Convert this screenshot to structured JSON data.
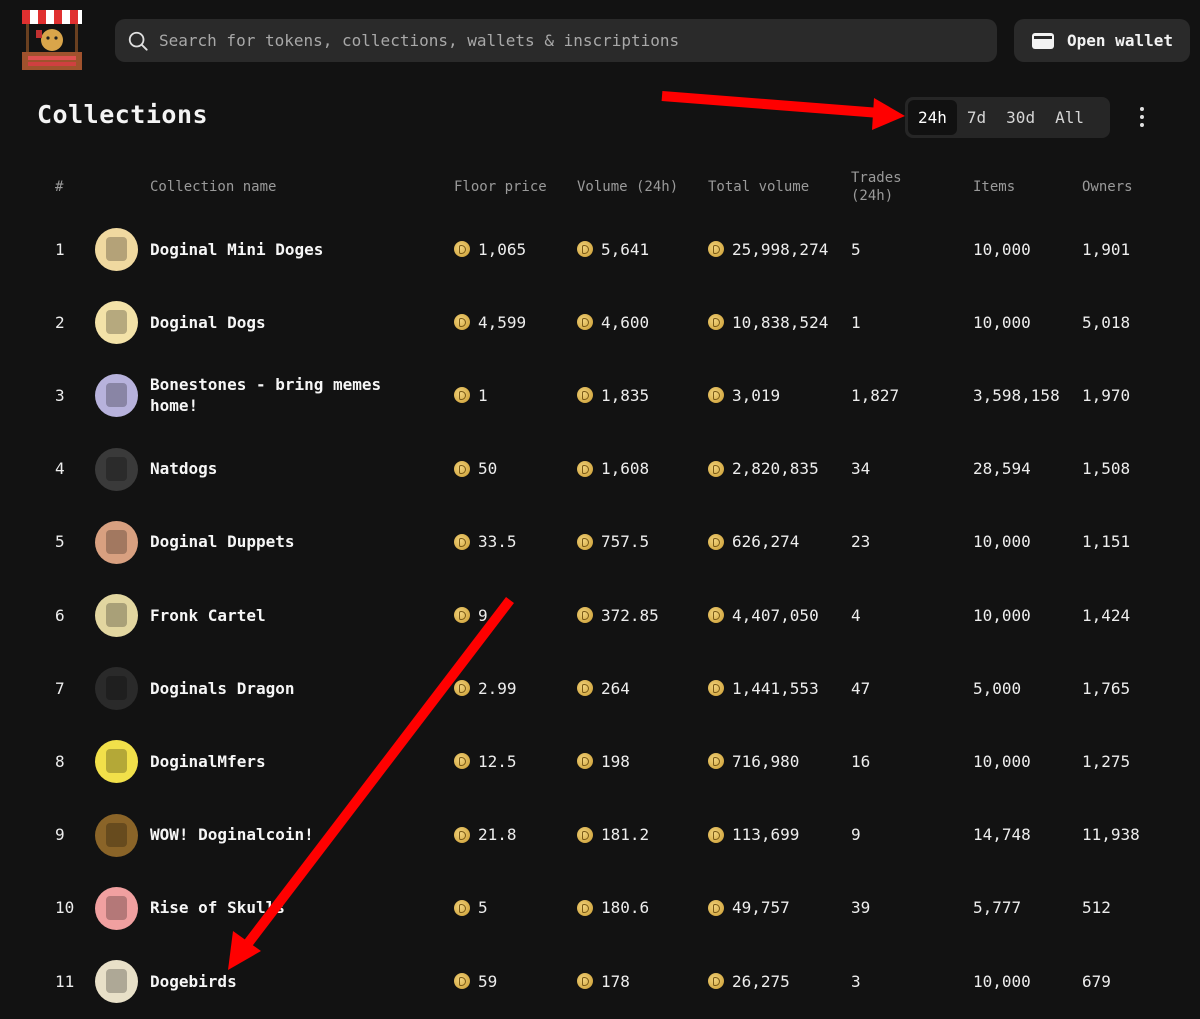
{
  "search": {
    "placeholder": "Search for tokens, collections, wallets & inscriptions"
  },
  "wallet": {
    "label": "Open wallet"
  },
  "header": {
    "title": "Collections",
    "ranges": [
      "24h",
      "7d",
      "30d",
      "All"
    ],
    "active_range": "24h"
  },
  "table": {
    "columns": {
      "rank": "#",
      "name": "Collection name",
      "floor": "Floor price",
      "volume": "Volume (24h)",
      "total": "Total volume",
      "trades": "Trades (24h)",
      "items": "Items",
      "owners": "Owners"
    },
    "rows": [
      {
        "rank": "1",
        "name": "Doginal Mini Doges",
        "floor": "1,065",
        "volume": "5,641",
        "total": "25,998,274",
        "trades": "5",
        "items": "10,000",
        "owners": "1,901",
        "avatar_color": "#f0d9a0"
      },
      {
        "rank": "2",
        "name": "Doginal Dogs",
        "floor": "4,599",
        "volume": "4,600",
        "total": "10,838,524",
        "trades": "1",
        "items": "10,000",
        "owners": "5,018",
        "avatar_color": "#f3e2a8"
      },
      {
        "rank": "3",
        "name": "Bonestones - bring memes home!",
        "floor": "1",
        "volume": "1,835",
        "total": "3,019",
        "trades": "1,827",
        "items": "3,598,158",
        "owners": "1,970",
        "avatar_color": "#b7b2dc"
      },
      {
        "rank": "4",
        "name": "Natdogs",
        "floor": "50",
        "volume": "1,608",
        "total": "2,820,835",
        "trades": "34",
        "items": "28,594",
        "owners": "1,508",
        "avatar_color": "#3a3a3a"
      },
      {
        "rank": "5",
        "name": "Doginal Duppets",
        "floor": "33.5",
        "volume": "757.5",
        "total": "626,274",
        "trades": "23",
        "items": "10,000",
        "owners": "1,151",
        "avatar_color": "#d8a080"
      },
      {
        "rank": "6",
        "name": "Fronk Cartel",
        "floor": "9",
        "volume": "372.85",
        "total": "4,407,050",
        "trades": "4",
        "items": "10,000",
        "owners": "1,424",
        "avatar_color": "#e2d6a0"
      },
      {
        "rank": "7",
        "name": "Doginals Dragon",
        "floor": "2.99",
        "volume": "264",
        "total": "1,441,553",
        "trades": "47",
        "items": "5,000",
        "owners": "1,765",
        "avatar_color": "#2a2a2a"
      },
      {
        "rank": "8",
        "name": "DoginalMfers",
        "floor": "12.5",
        "volume": "198",
        "total": "716,980",
        "trades": "16",
        "items": "10,000",
        "owners": "1,275",
        "avatar_color": "#f1e04a"
      },
      {
        "rank": "9",
        "name": "WOW! Doginalcoin!",
        "floor": "21.8",
        "volume": "181.2",
        "total": "113,699",
        "trades": "9",
        "items": "14,748",
        "owners": "11,938",
        "avatar_color": "#8a6428"
      },
      {
        "rank": "10",
        "name": "Rise of Skulls",
        "floor": "5",
        "volume": "180.6",
        "total": "49,757",
        "trades": "39",
        "items": "5,777",
        "owners": "512",
        "avatar_color": "#f0a0a0"
      },
      {
        "rank": "11",
        "name": "Dogebirds",
        "floor": "59",
        "volume": "178",
        "total": "26,275",
        "trades": "3",
        "items": "10,000",
        "owners": "679",
        "avatar_color": "#e8e0c8"
      }
    ]
  },
  "colors": {
    "background": "#121212",
    "surface": "#2a2a2a",
    "annotation_arrow": "#ff0000"
  }
}
